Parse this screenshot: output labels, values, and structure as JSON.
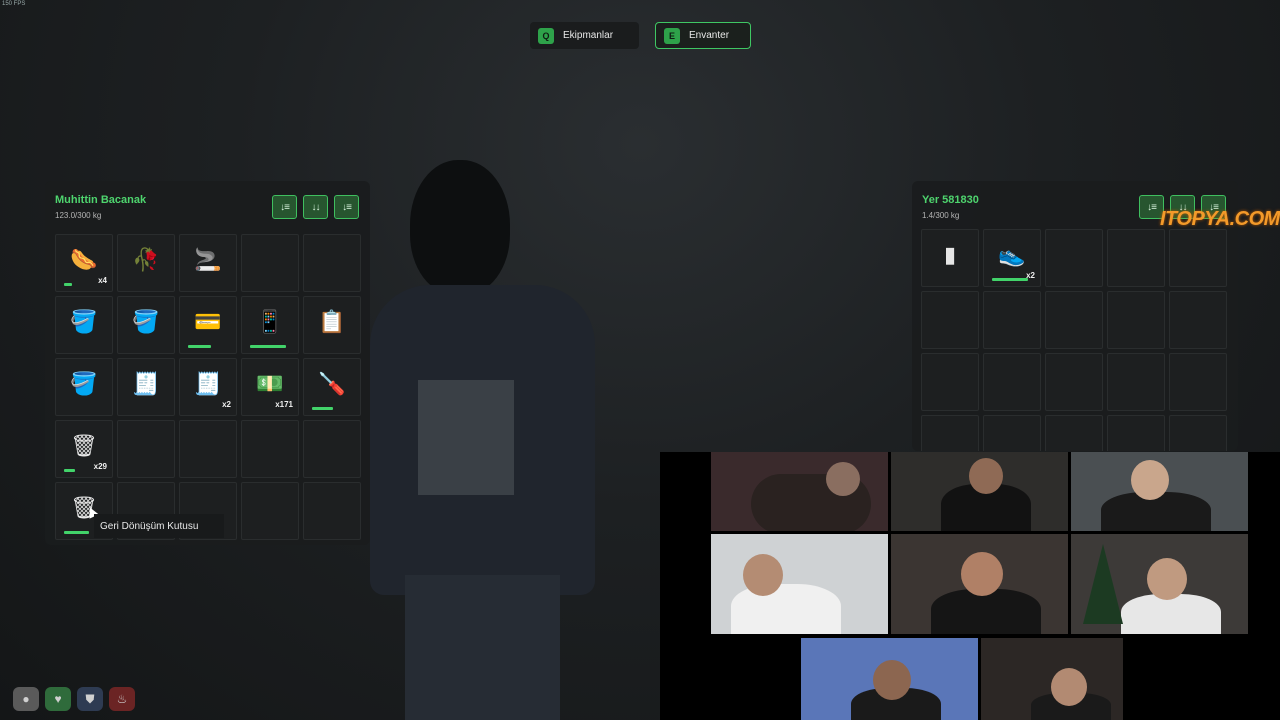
{
  "fps": "150 FPS",
  "tabs": [
    {
      "key": "Q",
      "label": "Ekipmanlar"
    },
    {
      "key": "E",
      "label": "Envanter"
    }
  ],
  "player_inventory": {
    "name": "Muhittin Bacanak",
    "weight": "123.0/300 kg",
    "sort_buttons": [
      "↓≡",
      "↓↓",
      "↓≡"
    ],
    "slots": [
      {
        "icon": "hotdog-icon",
        "glyph": "🌭",
        "count": "x4",
        "durability": 0.2
      },
      {
        "icon": "plant-icon",
        "glyph": "🥀",
        "count": "",
        "durability": null
      },
      {
        "icon": "cigarette-icon",
        "glyph": "🚬",
        "count": "",
        "durability": null
      },
      {
        "icon": "",
        "glyph": "",
        "count": "",
        "durability": null
      },
      {
        "icon": "",
        "glyph": "",
        "count": "",
        "durability": null
      },
      {
        "icon": "bucket-icon",
        "glyph": "🪣",
        "count": "",
        "durability": null
      },
      {
        "icon": "bucket-icon",
        "glyph": "🪣",
        "count": "",
        "durability": null
      },
      {
        "icon": "card-icon",
        "glyph": "💳",
        "count": "",
        "durability": 0.55
      },
      {
        "icon": "phone-icon",
        "glyph": "📱",
        "count": "",
        "durability": 0.85
      },
      {
        "icon": "clipboard-icon",
        "glyph": "📋",
        "count": "",
        "durability": null
      },
      {
        "icon": "bucket-icon",
        "glyph": "🪣",
        "count": "",
        "durability": null
      },
      {
        "icon": "receipt-icon",
        "glyph": "🧾",
        "count": "",
        "durability": null
      },
      {
        "icon": "receipt-icon",
        "glyph": "🧾",
        "count": "x2",
        "durability": null
      },
      {
        "icon": "cash-icon",
        "glyph": "💵",
        "count": "x171",
        "durability": null
      },
      {
        "icon": "screwdriver-icon",
        "glyph": "🪛",
        "count": "",
        "durability": 0.5
      },
      {
        "icon": "recycle-box-icon",
        "glyph": "🗑",
        "count": "x29",
        "durability": 0.25
      },
      {
        "icon": "",
        "glyph": "",
        "count": "",
        "durability": null
      },
      {
        "icon": "",
        "glyph": "",
        "count": "",
        "durability": null
      },
      {
        "icon": "",
        "glyph": "",
        "count": "",
        "durability": null
      },
      {
        "icon": "",
        "glyph": "",
        "count": "",
        "durability": null
      },
      {
        "icon": "recycle-box-icon",
        "glyph": "🗑",
        "count": "x1",
        "durability": 0.6
      },
      {
        "icon": "",
        "glyph": "",
        "count": "",
        "durability": null
      },
      {
        "icon": "",
        "glyph": "",
        "count": "",
        "durability": null
      },
      {
        "icon": "",
        "glyph": "",
        "count": "",
        "durability": null
      },
      {
        "icon": "",
        "glyph": "",
        "count": "",
        "durability": null
      }
    ]
  },
  "ground_inventory": {
    "name": "Yer 581830",
    "weight": "1.4/300 kg",
    "sort_buttons": [
      "↓≡",
      "↓↓",
      "↓≡"
    ],
    "slots": [
      {
        "icon": "phone-icon",
        "glyph": "▮",
        "count": "",
        "durability": null
      },
      {
        "icon": "sneakers-icon",
        "glyph": "👟",
        "count": "x2",
        "durability": 0.85
      },
      {
        "icon": "",
        "glyph": "",
        "count": "",
        "durability": null
      },
      {
        "icon": "",
        "glyph": "",
        "count": "",
        "durability": null
      },
      {
        "icon": "",
        "glyph": "",
        "count": "",
        "durability": null
      },
      {
        "icon": "",
        "glyph": "",
        "count": "",
        "durability": null
      },
      {
        "icon": "",
        "glyph": "",
        "count": "",
        "durability": null
      },
      {
        "icon": "",
        "glyph": "",
        "count": "",
        "durability": null
      },
      {
        "icon": "",
        "glyph": "",
        "count": "",
        "durability": null
      },
      {
        "icon": "",
        "glyph": "",
        "count": "",
        "durability": null
      },
      {
        "icon": "",
        "glyph": "",
        "count": "",
        "durability": null
      },
      {
        "icon": "",
        "glyph": "",
        "count": "",
        "durability": null
      },
      {
        "icon": "",
        "glyph": "",
        "count": "",
        "durability": null
      },
      {
        "icon": "",
        "glyph": "",
        "count": "",
        "durability": null
      },
      {
        "icon": "",
        "glyph": "",
        "count": "",
        "durability": null
      },
      {
        "icon": "",
        "glyph": "",
        "count": "",
        "durability": null
      },
      {
        "icon": "",
        "glyph": "",
        "count": "",
        "durability": null
      },
      {
        "icon": "",
        "glyph": "",
        "count": "",
        "durability": null
      },
      {
        "icon": "",
        "glyph": "",
        "count": "",
        "durability": null
      },
      {
        "icon": "",
        "glyph": "",
        "count": "",
        "durability": null
      }
    ]
  },
  "tooltip": "Geri Dönüşüm Kutusu",
  "watermark": "ITOPYA.COM",
  "hud": [
    {
      "icon": "person-icon",
      "glyph": "●",
      "color": "#5a5a5a"
    },
    {
      "icon": "heart-icon",
      "glyph": "♥",
      "color": "#2f6b3b"
    },
    {
      "icon": "shield-icon",
      "glyph": "⛊",
      "color": "#2e3b52"
    },
    {
      "icon": "food-icon",
      "glyph": "♨",
      "color": "#6b2424"
    }
  ],
  "colors": {
    "accent": "#42d36a",
    "panel": "#1a1c1d",
    "watermark": "#f39a2a"
  }
}
